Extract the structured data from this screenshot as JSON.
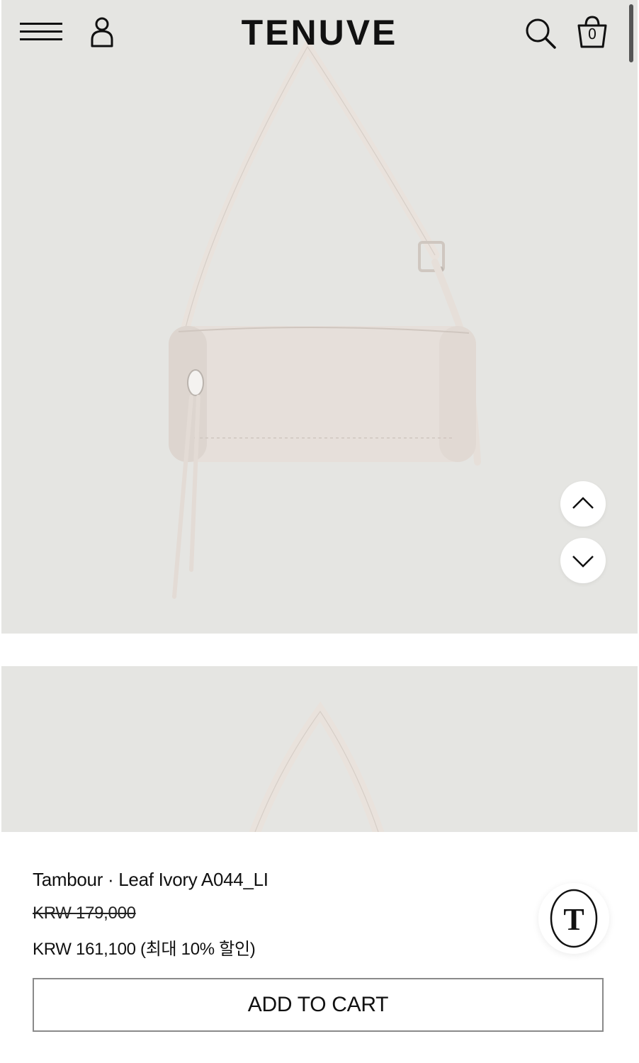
{
  "header": {
    "logo": "TENUVE",
    "cart_count": "0"
  },
  "product": {
    "name": "Tambour · Leaf Ivory A044_LI",
    "original_price": "KRW 179,000",
    "sale_price": "KRW 161,100 (최대 10% 할인)",
    "add_to_cart_label": "ADD TO CART"
  },
  "badge": {
    "letter": "T"
  },
  "colors": {
    "image_bg": "#e5e5e2",
    "bag": "#e6dfda",
    "text": "#111111"
  },
  "icons": [
    "menu-icon",
    "user-icon",
    "search-icon",
    "shopping-bag-icon",
    "chevron-up-icon",
    "chevron-down-icon"
  ]
}
